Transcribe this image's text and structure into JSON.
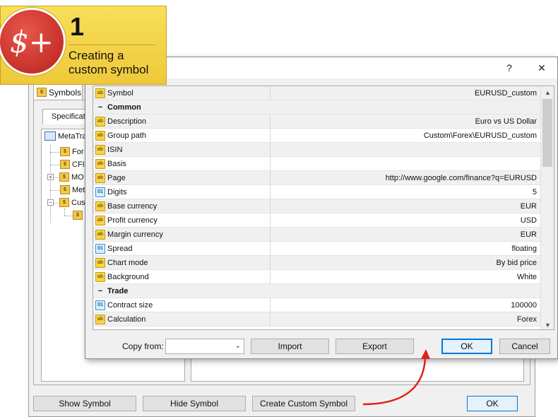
{
  "badge": {
    "symbol": "$+",
    "number": "1",
    "line1": "Creating a",
    "line2": "custom symbol"
  },
  "background_window": {
    "tab_label": "Symbols",
    "subtab_label": "Specification",
    "tree": [
      {
        "label": "MetaTra",
        "icon": "computer-icon"
      },
      {
        "label": "For",
        "icon": "folder-icon"
      },
      {
        "label": "CFI",
        "icon": "folder-icon"
      },
      {
        "label": "MO",
        "icon": "folder-icon"
      },
      {
        "label": "Met",
        "icon": "folder-icon"
      },
      {
        "label": "Cus",
        "icon": "folder-gear-icon"
      },
      {
        "label": "",
        "icon": "folder-gear-icon"
      }
    ],
    "buttons": {
      "show_symbol": "Show Symbol",
      "hide_symbol": "Hide Symbol",
      "create_custom_symbol": "Create Custom Symbol",
      "ok": "OK"
    }
  },
  "dialog": {
    "help": "?",
    "close": "✕",
    "rows": [
      {
        "type": "prop",
        "icon": "ab",
        "name": "Symbol",
        "value": "EURUSD_custom"
      },
      {
        "type": "section",
        "name": "Common"
      },
      {
        "type": "prop",
        "icon": "ab",
        "name": "Description",
        "value": "Euro vs US Dollar"
      },
      {
        "type": "prop",
        "icon": "ab",
        "name": "Group path",
        "value": "Custom\\Forex\\EURUSD_custom"
      },
      {
        "type": "prop",
        "icon": "ab",
        "name": "ISIN",
        "value": ""
      },
      {
        "type": "prop",
        "icon": "ab",
        "name": "Basis",
        "value": ""
      },
      {
        "type": "prop",
        "icon": "ab",
        "name": "Page",
        "value": "http://www.google.com/finance?q=EURUSD"
      },
      {
        "type": "prop",
        "icon": "01",
        "name": "Digits",
        "value": "5"
      },
      {
        "type": "prop",
        "icon": "ab",
        "name": "Base currency",
        "value": "EUR"
      },
      {
        "type": "prop",
        "icon": "ab",
        "name": "Profit currency",
        "value": "USD"
      },
      {
        "type": "prop",
        "icon": "ab",
        "name": "Margin currency",
        "value": "EUR"
      },
      {
        "type": "prop",
        "icon": "01",
        "name": "Spread",
        "value": "floating"
      },
      {
        "type": "prop",
        "icon": "ab",
        "name": "Chart mode",
        "value": "By bid price"
      },
      {
        "type": "prop",
        "icon": "ab",
        "name": "Background",
        "value": "White"
      },
      {
        "type": "section",
        "name": "Trade"
      },
      {
        "type": "prop",
        "icon": "01",
        "name": "Contract size",
        "value": "100000"
      },
      {
        "type": "prop",
        "icon": "ab",
        "name": "Calculation",
        "value": "Forex"
      }
    ],
    "copy_from_label": "Copy from:",
    "copy_from_value": "",
    "buttons": {
      "import": "Import",
      "export": "Export",
      "ok": "OK",
      "cancel": "Cancel"
    }
  },
  "colors": {
    "accent": "#0078d7",
    "badge_yellow": "#f5d44a",
    "badge_red": "#d0342c",
    "arrow_red": "#e0201a"
  }
}
